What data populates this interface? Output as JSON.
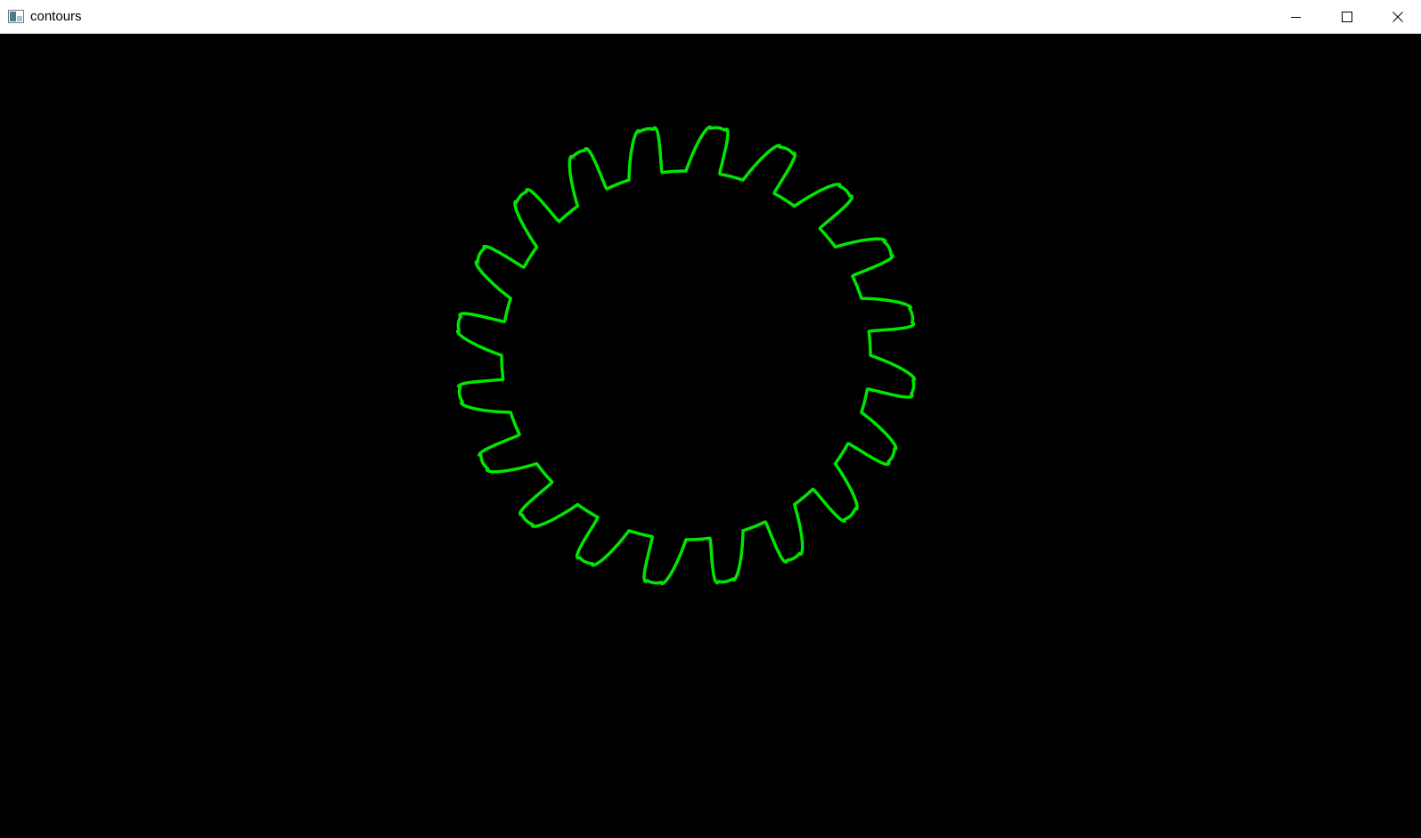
{
  "window": {
    "title": "contours",
    "controls": {
      "minimize": "minimize-icon",
      "maximize": "maximize-icon",
      "close": "close-icon"
    }
  },
  "canvas": {
    "background": "#000000",
    "contour_color": "#00e600"
  }
}
